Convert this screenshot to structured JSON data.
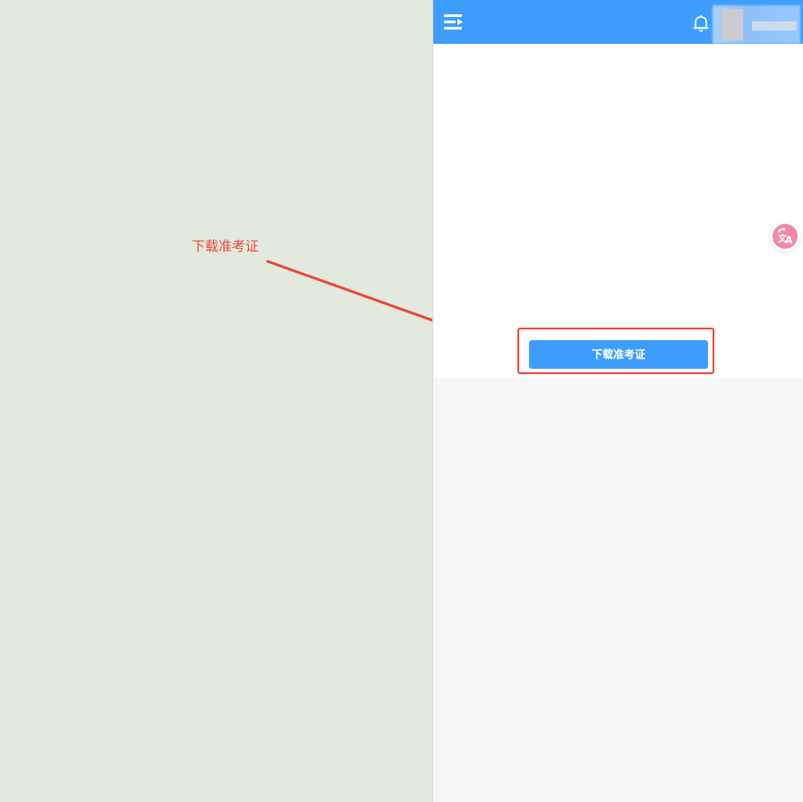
{
  "annotation": {
    "label": "下载准考证",
    "color": "#e8473c"
  },
  "header": {
    "background": "#3f9dfd",
    "menu_icon": "menu-collapse-icon",
    "notification_icon": "bell-icon"
  },
  "main": {
    "download_button_label": "下载准考证",
    "button_color": "#3f9dfd"
  },
  "floating": {
    "translate_icon": "translate-icon",
    "color": "#ef8aa6"
  }
}
